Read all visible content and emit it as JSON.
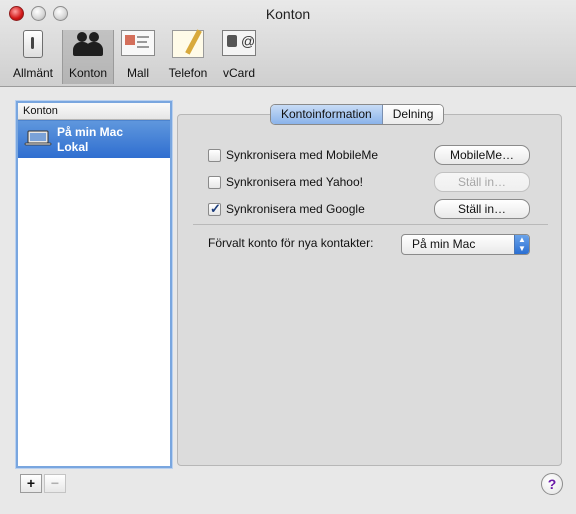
{
  "window": {
    "title": "Konton"
  },
  "toolbar": {
    "items": [
      {
        "label": "Allmänt"
      },
      {
        "label": "Konton"
      },
      {
        "label": "Mall"
      },
      {
        "label": "Telefon"
      },
      {
        "label": "vCard"
      }
    ],
    "selected": "Konton"
  },
  "sidebar": {
    "header": "Konton",
    "accounts": [
      {
        "line1": "På min Mac",
        "line2": "Lokal",
        "selected": true
      }
    ]
  },
  "tabs": {
    "active": "Kontoinformation",
    "items": [
      "Kontoinformation",
      "Delning"
    ]
  },
  "sync": [
    {
      "label": "Synkronisera med MobileMe",
      "checked": false,
      "button": "MobileMe…",
      "enabled": true
    },
    {
      "label": "Synkronisera med Yahoo!",
      "checked": false,
      "button": "Ställ in…",
      "enabled": false
    },
    {
      "label": "Synkronisera med Google",
      "checked": true,
      "button": "Ställ in…",
      "enabled": true
    }
  ],
  "default_account": {
    "label": "Förvalt konto för nya kontakter:",
    "value": "På min Mac"
  },
  "bottom_buttons": {
    "add": "+",
    "remove": "−"
  },
  "help": {
    "label": "?"
  },
  "colors": {
    "selection": "#3b78d6",
    "help_purple": "#6a1aa8"
  }
}
